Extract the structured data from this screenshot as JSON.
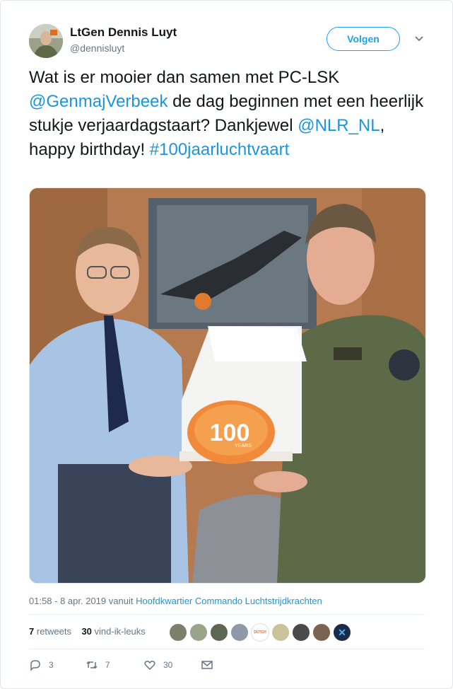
{
  "author": {
    "display_name": "LtGen Dennis Luyt",
    "handle": "@dennisluyt"
  },
  "follow_label": "Volgen",
  "tweet": {
    "part1": "Wat is er mooier dan samen met PC-LSK ",
    "mention1": "@GenmajVerbeek",
    "part2": " de dag beginnen met een heerlijk stukje verjaardagstaart? Dankjewel ",
    "mention2": "@NLR_NL",
    "part3": ", happy birthday! ",
    "hashtag": "#100jaarluchtvaart"
  },
  "photo": {
    "cake_text": "100",
    "cake_subtext": "YEARS"
  },
  "meta": {
    "timestamp": "01:58 - 8 apr. 2019 vanuit ",
    "location": "Hoofdkwartier Commando Luchtstrijdkrachten"
  },
  "stats": {
    "retweets_count": "7",
    "retweets_label": "retweets",
    "likes_count": "30",
    "likes_label": "vind-ik-leuks",
    "liker_avatar_logo_text": "DUTCH"
  },
  "actions": {
    "reply_count": "3",
    "retweet_count": "7",
    "like_count": "30"
  },
  "colors": {
    "link": "#1b95e0",
    "follow": "#1da1f2",
    "muted": "#657786"
  }
}
